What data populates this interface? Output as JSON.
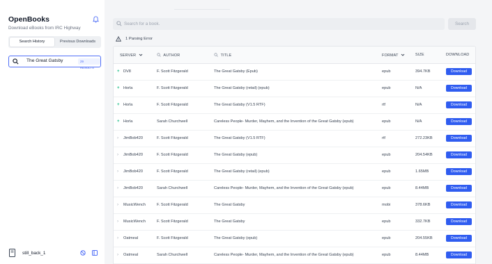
{
  "app": {
    "title": "OpenBooks",
    "subtitle": "Download eBooks from IRC Highway"
  },
  "sidebar": {
    "tabs": [
      {
        "label": "Search History",
        "active": true
      },
      {
        "label": "Previous Downloads",
        "active": false
      }
    ],
    "history": [
      {
        "query": "The Great Gatsby",
        "badge": "29 RESULTS"
      }
    ],
    "user": {
      "name": "still_back_1"
    }
  },
  "search": {
    "placeholder": "Search for a book.",
    "value": "",
    "button_label": "Search"
  },
  "errors": {
    "text": "1 Parsing Error"
  },
  "table": {
    "columns": [
      "SERVER",
      "AUTHOR",
      "TITLE",
      "FORMAT",
      "SIZE",
      "DOWNLOAD"
    ],
    "download_label": "Download",
    "rows": [
      {
        "mark": "+",
        "server": "DV8",
        "author": "F. Scott Fitzgerald",
        "title": "The Great Gatsby (Epub)",
        "format": "epub",
        "size": "394.7KB"
      },
      {
        "mark": "+",
        "server": "Horla",
        "author": "F. Scott Fitzgerald",
        "title": "The Great Gatsby (retail) (epub)",
        "format": "epub",
        "size": "N/A"
      },
      {
        "mark": "+",
        "server": "Horla",
        "author": "F. Scott Fitzgerald",
        "title": "The Great Gatsby (V1.5 RTF)",
        "format": "rtf",
        "size": "N/A"
      },
      {
        "mark": "+",
        "server": "Horla",
        "author": "Sarah Churchwell",
        "title": "Careless People- Murder, Mayhem, and the Invention of the Great Gatsby (epub)",
        "format": "epub",
        "size": "N/A"
      },
      {
        "mark": "›",
        "server": "JimBob420",
        "author": "F. Scott Fitzgerald",
        "title": "The Great Gatsby (V1.5 RTF)",
        "format": "rtf",
        "size": "272.23KB"
      },
      {
        "mark": "›",
        "server": "JimBob420",
        "author": "F. Scott Fitzgerald",
        "title": "The Great Gatsby (epub)",
        "format": "epub",
        "size": "204.54KB"
      },
      {
        "mark": "›",
        "server": "JimBob420",
        "author": "F. Scott Fitzgerald",
        "title": "The Great Gatsby (retail) (epub)",
        "format": "epub",
        "size": "1.65MB"
      },
      {
        "mark": "›",
        "server": "JimBob420",
        "author": "Sarah Churchwell",
        "title": "Careless People- Murder, Mayhem, and the Invention of the Great Gatsby (epub)",
        "format": "epub",
        "size": "8.44MB"
      },
      {
        "mark": "›",
        "server": "MusicWench",
        "author": "F. Scott Fitzgerald",
        "title": "The Great Gatsby",
        "format": "mobi",
        "size": "378.6KB"
      },
      {
        "mark": "›",
        "server": "MusicWench",
        "author": "F. Scott Fitzgerald",
        "title": "The Great Gatsby",
        "format": "epub",
        "size": "332.7KB"
      },
      {
        "mark": "›",
        "server": "Oatmeal",
        "author": "F. Scott Fitzgerald",
        "title": "The Great Gatsby (epub)",
        "format": "epub",
        "size": "204.55KB"
      },
      {
        "mark": "›",
        "server": "Oatmeal",
        "author": "Sarah Churchwell",
        "title": "Careless People- Murder, Mayhem, and the Invention of the Great Gatsby (epub)",
        "format": "epub",
        "size": "8.44MB"
      }
    ]
  },
  "colors": {
    "accent": "#2f5cf0",
    "success": "#10b981",
    "background": "#f4f5f7"
  },
  "icons": [
    "bell-icon",
    "search-icon",
    "warning-icon",
    "chevron-down-icon",
    "user-icon",
    "sort-icon",
    "book-icon",
    "logout-icon",
    "settings-icon"
  ]
}
